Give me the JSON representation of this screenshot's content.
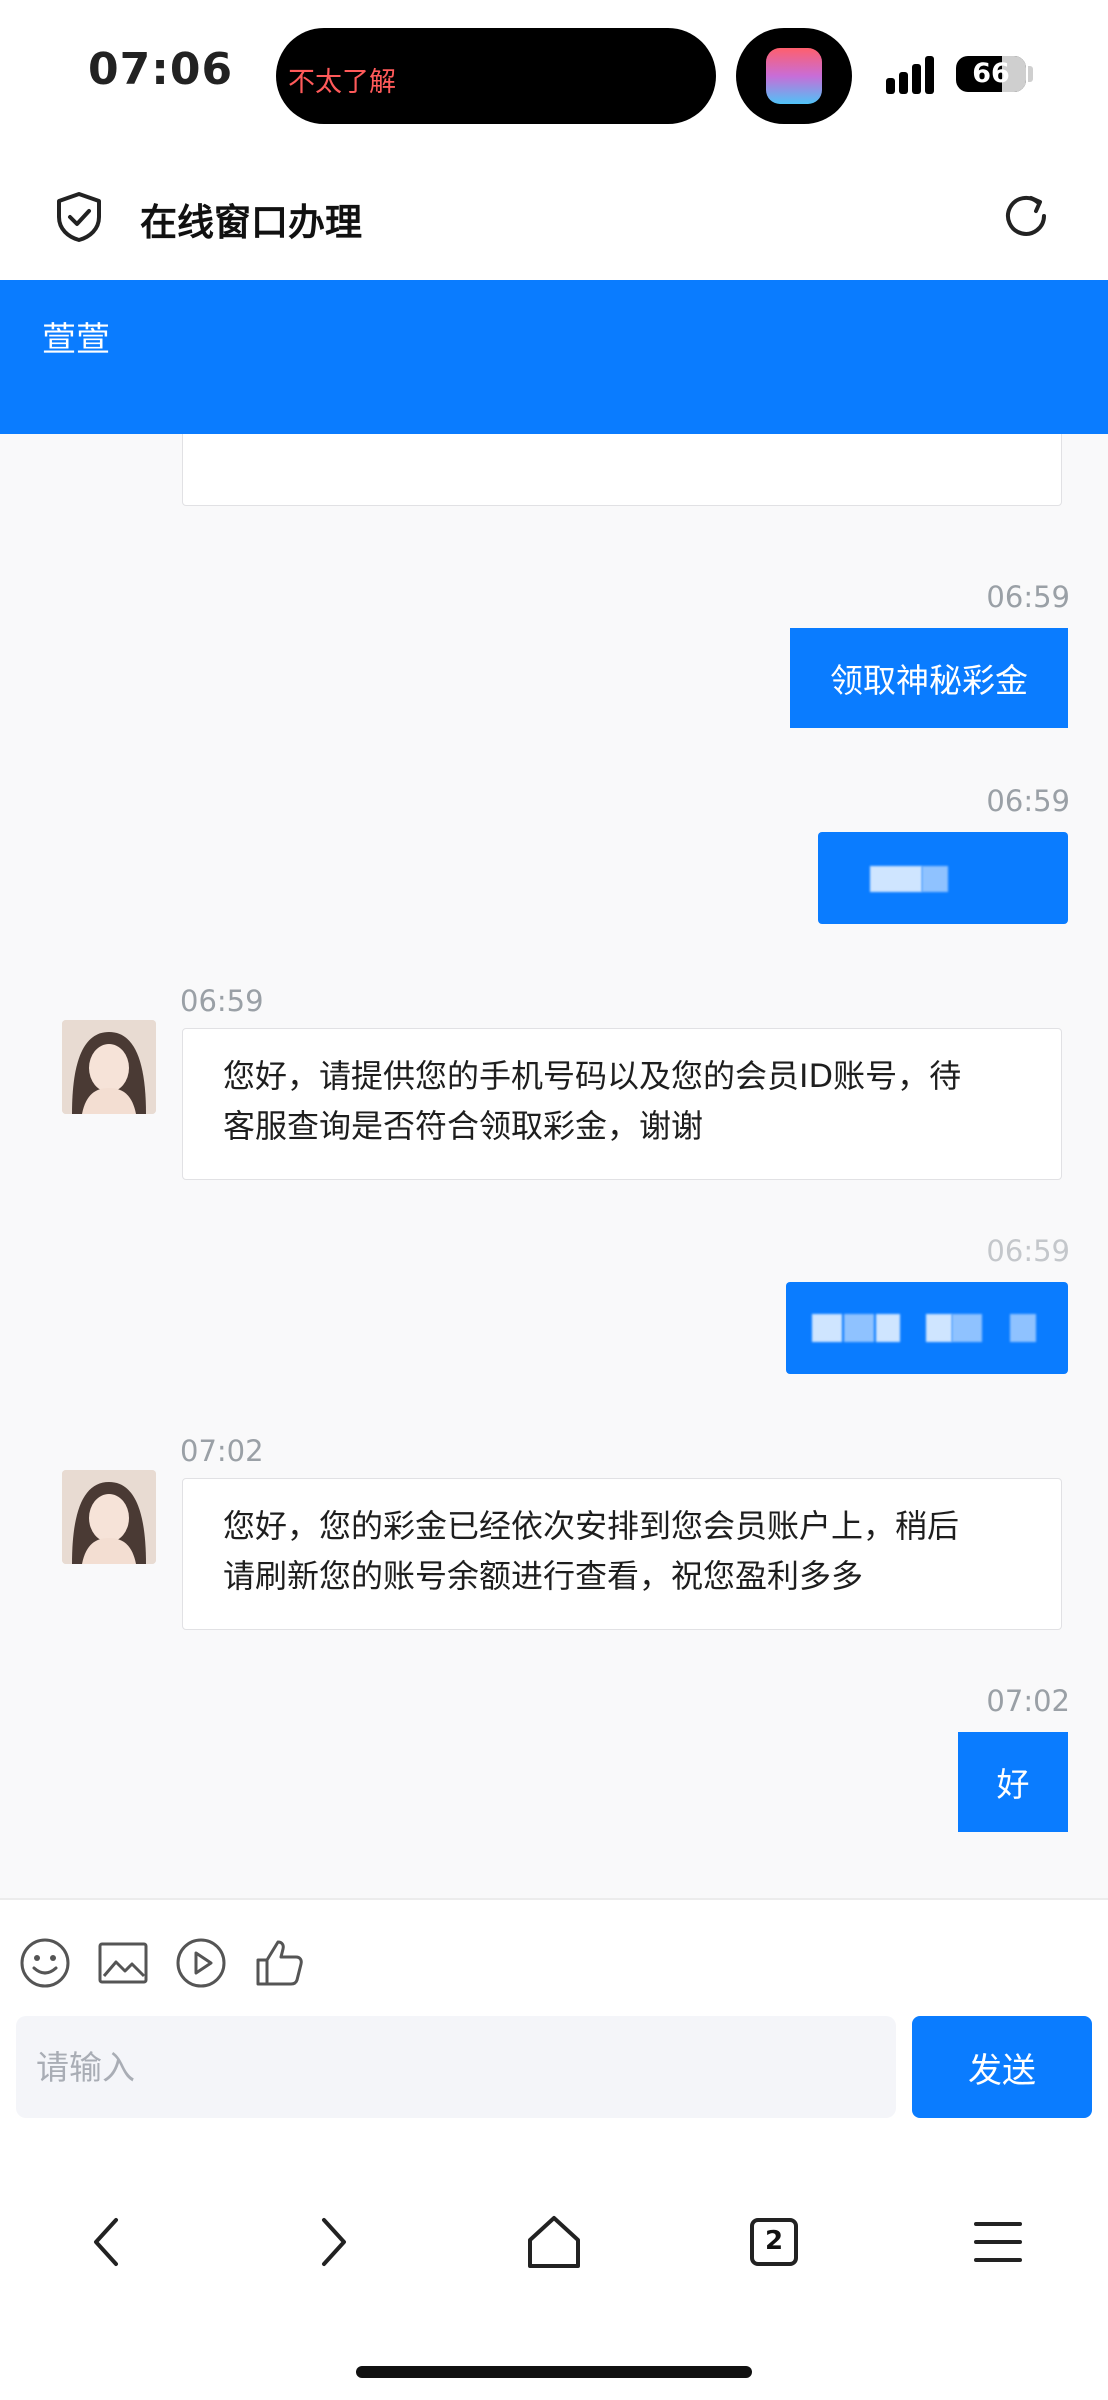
{
  "status_bar": {
    "time": "07:06",
    "island_text": "不太了解",
    "battery": "66"
  },
  "header": {
    "title": "在线窗口办理",
    "agent_name": "萱萱"
  },
  "messages": [
    {
      "side": "out",
      "time": "06:59",
      "text": "领取神秘彩金"
    },
    {
      "side": "out",
      "time": "06:59",
      "redacted": true
    },
    {
      "side": "in",
      "time": "06:59",
      "lines": [
        "您好，请提供您的手机号码以及您的会员ID账号，待",
        "客服查询是否符合领取彩金，谢谢"
      ]
    },
    {
      "side": "out",
      "time": "06:59",
      "redacted": true
    },
    {
      "side": "in",
      "time": "07:02",
      "lines": [
        "您好，您的彩金已经依次安排到您会员账户上，稍后",
        "请刷新您的账号余额进行查看，祝您盈利多多"
      ]
    },
    {
      "side": "out",
      "time": "07:02",
      "text": "好"
    }
  ],
  "toolbar": {
    "icons": [
      "emoji-icon",
      "image-icon",
      "video-icon",
      "thumbs-up-icon"
    ]
  },
  "input": {
    "placeholder": "请输入",
    "send_label": "发送"
  },
  "browser_nav": {
    "tab_count": "2"
  },
  "colors": {
    "accent": "#0a7cff",
    "chat_background": "#f9f9fa",
    "timestamp": "#9aa0a6"
  }
}
